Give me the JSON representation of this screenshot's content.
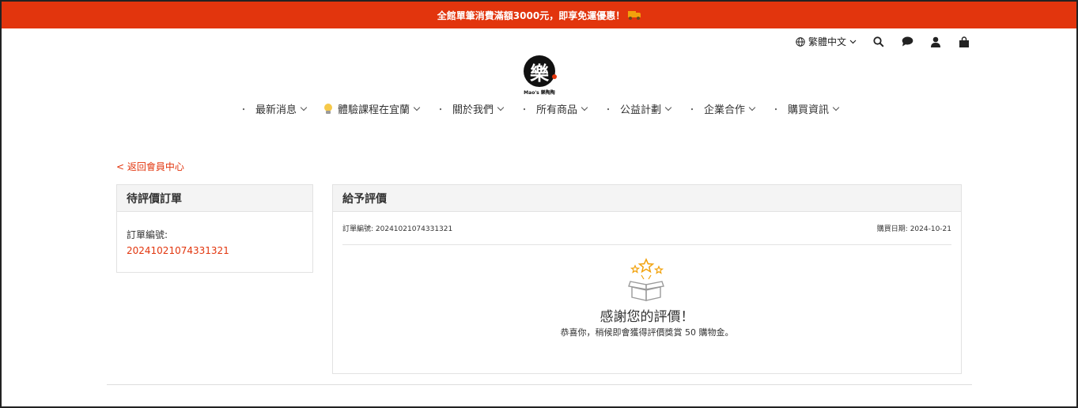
{
  "promo": {
    "text": "全館單筆消費滿額3000元，即享免運優惠！",
    "icon": "truck-icon"
  },
  "utils": {
    "language": "繁體中文"
  },
  "logo": {
    "mark": "樂",
    "tagline": "Mao's 樂陶陶"
  },
  "nav": [
    {
      "label": "最新消息",
      "bullet": "・"
    },
    {
      "label": "體驗課程在宜蘭",
      "icon": "lightbulb-icon"
    },
    {
      "label": "關於我們",
      "bullet": "・"
    },
    {
      "label": "所有商品",
      "bullet": "・"
    },
    {
      "label": "公益計劃",
      "bullet": "・"
    },
    {
      "label": "企業合作",
      "bullet": "・"
    },
    {
      "label": "購買資訊",
      "bullet": "・"
    }
  ],
  "back_link": "< 返回會員中心",
  "pending": {
    "title": "待評價訂單",
    "order_label": "訂單編號:",
    "order_number": "20241021074331321"
  },
  "review": {
    "title": "給予評價",
    "order_meta": "訂單編號: 20241021074331321",
    "date_meta": "購買日期: 2024-10-21",
    "thanks": "感謝您的評價！",
    "reward": "恭喜你，稍候即會獲得評價獎賞 50 購物金。"
  },
  "colors": {
    "accent": "#e2350d",
    "panel_header": "#f4f4f4",
    "star": "#f2a20c"
  }
}
